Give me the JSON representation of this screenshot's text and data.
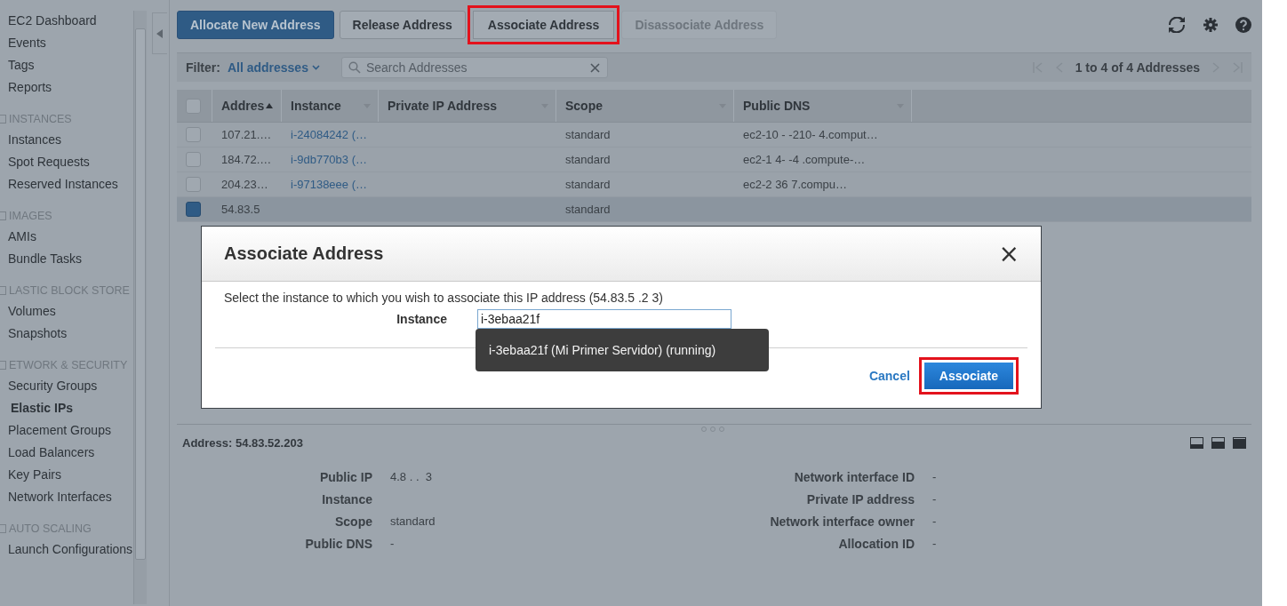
{
  "sidebar": {
    "sections": [
      {
        "items": [
          {
            "label": "EC2 Dashboard",
            "selected": false
          },
          {
            "label": "Events",
            "selected": false
          },
          {
            "label": "Tags",
            "selected": false
          },
          {
            "label": "Reports",
            "selected": false
          }
        ]
      },
      {
        "heading": "INSTANCES",
        "items": [
          {
            "label": "Instances",
            "selected": false
          },
          {
            "label": "Spot Requests",
            "selected": false
          },
          {
            "label": "Reserved Instances",
            "selected": false
          }
        ]
      },
      {
        "heading": "IMAGES",
        "items": [
          {
            "label": "AMIs",
            "selected": false
          },
          {
            "label": "Bundle Tasks",
            "selected": false
          }
        ]
      },
      {
        "heading": "LASTIC BLOCK STORE",
        "items": [
          {
            "label": "Volumes",
            "selected": false
          },
          {
            "label": "Snapshots",
            "selected": false
          }
        ]
      },
      {
        "heading": "ETWORK & SECURITY",
        "items": [
          {
            "label": "Security Groups",
            "selected": false
          },
          {
            "label": "Elastic IPs",
            "selected": true
          },
          {
            "label": "Placement Groups",
            "selected": false
          },
          {
            "label": "Load Balancers",
            "selected": false
          },
          {
            "label": "Key Pairs",
            "selected": false
          },
          {
            "label": "Network Interfaces",
            "selected": false
          }
        ]
      },
      {
        "heading": "AUTO SCALING",
        "items": [
          {
            "label": "Launch Configurations",
            "selected": false
          }
        ]
      }
    ]
  },
  "toolbar": {
    "buttons": [
      {
        "label": "Allocate New Address",
        "kind": "primary",
        "highlighted": false
      },
      {
        "label": "Release Address",
        "kind": "default",
        "highlighted": false
      },
      {
        "label": "Associate Address",
        "kind": "default",
        "highlighted": true
      },
      {
        "label": "Disassociate Address",
        "kind": "disabled",
        "highlighted": false
      }
    ]
  },
  "filter": {
    "label": "Filter:",
    "value": "All addresses",
    "search_placeholder": "Search Addresses",
    "pagination": "1 to 4 of 4 Addresses"
  },
  "table": {
    "select_all_checked": false,
    "columns": [
      "Addres",
      "Instance",
      "Private IP Address",
      "Scope",
      "Public DNS"
    ],
    "rows": [
      {
        "selected": false,
        "cells": [
          "107.21.…",
          "i-24084242 (…",
          "",
          "standard",
          "ec2-10 -  -210-  4.comput…"
        ]
      },
      {
        "selected": false,
        "cells": [
          "184.72.…",
          "i-9db770b3 (…",
          "",
          "standard",
          "ec2-1 4-  -4  .compute-…"
        ]
      },
      {
        "selected": false,
        "cells": [
          "204.23…",
          "i-97138eee (…",
          "",
          "standard",
          "ec2-2  36   7.compu…"
        ]
      },
      {
        "selected": true,
        "cells": [
          "54.83.5",
          "",
          "",
          "standard",
          ""
        ]
      }
    ]
  },
  "details": {
    "title": "Address: 54.83.52.203",
    "left": [
      {
        "label": "Public IP",
        "value": "4.8 . .  3"
      },
      {
        "label": "Instance"
      },
      {
        "label": "Scope",
        "value": "standard"
      },
      {
        "label": "Public DNS",
        "value": "-"
      }
    ],
    "right": [
      {
        "label": "Network interface ID",
        "value": "-"
      },
      {
        "label": "Private IP address",
        "value": "-"
      },
      {
        "label": "Network interface owner",
        "value": "-"
      },
      {
        "label": "Allocation ID",
        "value": "-"
      }
    ]
  },
  "dialog": {
    "title": "Associate Address",
    "close": "×",
    "description": "Select the instance to which you wish to associate this IP address (54.83.5 .2 3)",
    "field_label": "Instance",
    "field_value": "i-3ebaa21f",
    "suggestion": "i-3ebaa21f (Mi Primer Servidor) (running)",
    "cancel": "Cancel",
    "confirm": {
      "label": "Associate",
      "highlighted": true
    }
  }
}
